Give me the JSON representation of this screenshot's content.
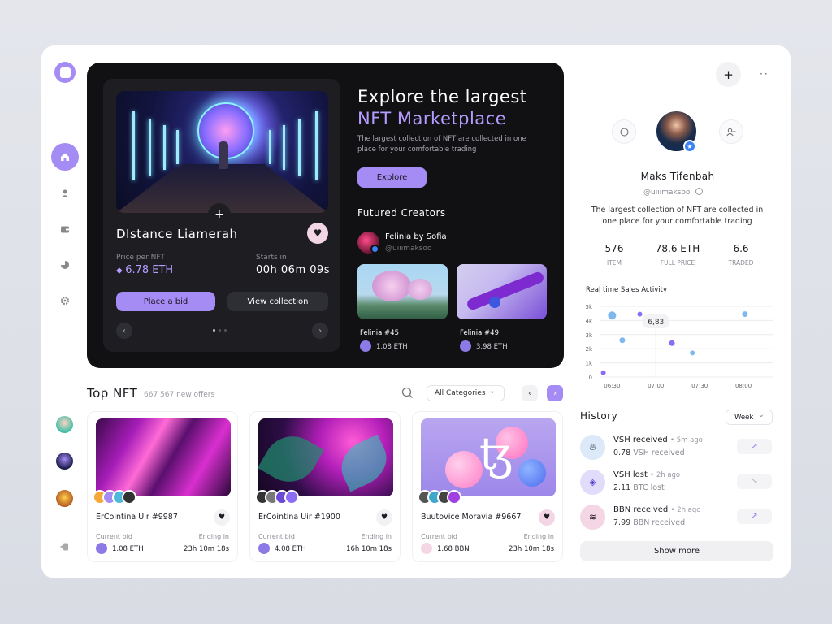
{
  "hero": {
    "card_title": "DIstance Liamerah",
    "price_label": "Price per NFT",
    "price_value": "6.78 ETH",
    "starts_label": "Starts in",
    "starts_value": "00h 06m 09s",
    "bid_button": "Place a bid",
    "view_button": "View collection",
    "plus_glyph": "+",
    "headline_line1": "Explore the largest",
    "headline_line2": "NFT Marketplace",
    "subtitle": "The largest collection of NFT are collected in one place for your comfortable trading",
    "explore_button": "Explore",
    "creators_title": "Futured Creators",
    "creator_name": "Felinia by Sofia",
    "creator_handle": "@uiiimaksoo",
    "featured": [
      {
        "name": "Felinia #45",
        "price": "1.08 ETH"
      },
      {
        "name": "Felinia #49",
        "price": "3.98 ETH"
      }
    ]
  },
  "top_nft": {
    "title": "Top NFT",
    "offers": "667 567 new offers",
    "category": "All Categories",
    "cards": [
      {
        "name": "ErCointina Uir #9987",
        "bid_label": "Current bid",
        "end_label": "Ending in",
        "bid": "1.08 ETH",
        "ending": "23h 10m 18s"
      },
      {
        "name": "ErCointina Uir #1900",
        "bid_label": "Current bid",
        "end_label": "Ending in",
        "bid": "4.08 ETH",
        "ending": "16h 10m 18s"
      },
      {
        "name": "Buutovice Moravia #9667",
        "bid_label": "Current bid",
        "end_label": "Ending in",
        "bid": "1.68 BBN",
        "ending": "23h 10m 18s"
      }
    ]
  },
  "profile": {
    "name": "Maks Tifenbah",
    "handle": "@uiiimaksoo",
    "description": "The largest collection of NFT are collected in one place for your comfortable trading",
    "stats": [
      {
        "value": "576",
        "label": "ITEM"
      },
      {
        "value": "78.6 ETH",
        "label": "FULL PRICE"
      },
      {
        "value": "6.6",
        "label": "TRADED"
      }
    ]
  },
  "chart_data": {
    "type": "scatter",
    "title": "Real time Sales Activity",
    "x_ticks": [
      "06:30",
      "07:00",
      "07:30",
      "08:00"
    ],
    "y_ticks": [
      "0",
      "1k",
      "2k",
      "3k",
      "4k",
      "5k"
    ],
    "ylim": [
      0,
      5000
    ],
    "tooltip": "6,83",
    "points": [
      {
        "x": "06:24",
        "y": 300,
        "color": "#8d6cf5"
      },
      {
        "x": "06:30",
        "y": 4350,
        "color": "#7fb7f0"
      },
      {
        "x": "06:37",
        "y": 2600,
        "color": "#7fb7f0"
      },
      {
        "x": "06:49",
        "y": 4450,
        "color": "#8d6cf5"
      },
      {
        "x": "07:11",
        "y": 2400,
        "color": "#8d6cf5"
      },
      {
        "x": "07:25",
        "y": 1700,
        "color": "#7fb7f0"
      },
      {
        "x": "08:01",
        "y": 4450,
        "color": "#7fb7f0"
      }
    ]
  },
  "history": {
    "title": "History",
    "period": "Week",
    "items": [
      {
        "title": "VSH received",
        "time": "5m ago",
        "amount": "0.78",
        "unit": "VSH received"
      },
      {
        "title": "VSH lost",
        "time": "2h ago",
        "amount": "2.11",
        "unit": "BTC lost"
      },
      {
        "title": "BBN received",
        "time": "2h ago",
        "amount": "7.99",
        "unit": "BBN received"
      }
    ],
    "show_more": "Show more"
  },
  "colors": {
    "accent": "#a58cf5",
    "dark": "#111114"
  },
  "icons": [
    "logo-icon",
    "home-icon",
    "user-icon",
    "wallet-icon",
    "chart-icon",
    "gear-icon",
    "logout-icon",
    "heart-icon",
    "search-icon",
    "plus-icon",
    "more-icon",
    "message-icon",
    "add-user-icon",
    "copy-icon",
    "trend-up-icon",
    "trend-down-icon"
  ]
}
